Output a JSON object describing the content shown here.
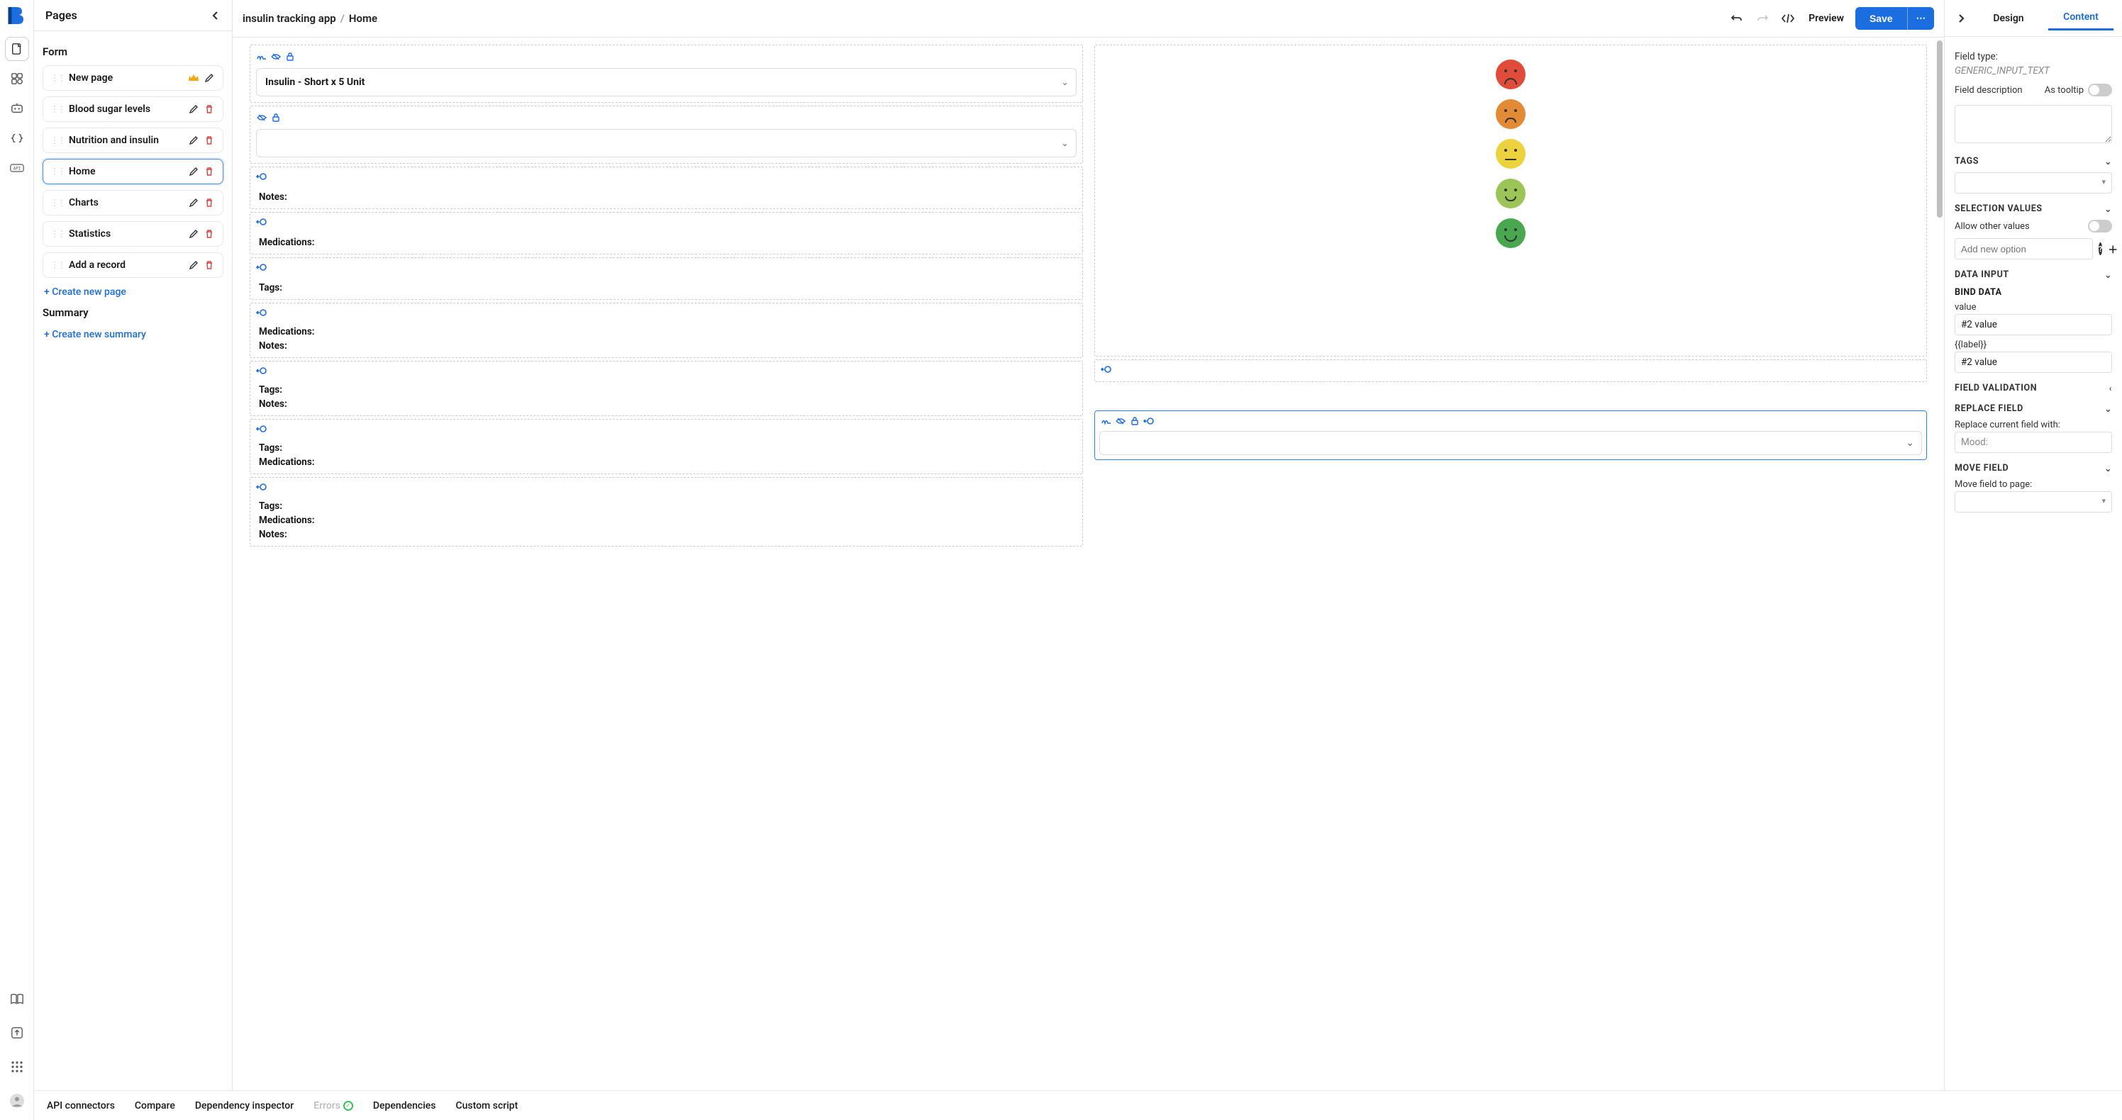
{
  "sidebar": {
    "title": "Pages",
    "sections": {
      "form": "Form",
      "summary": "Summary"
    },
    "pages": [
      {
        "label": "New page",
        "crown": true,
        "trash": false
      },
      {
        "label": "Blood sugar levels",
        "crown": false,
        "trash": true
      },
      {
        "label": "Nutrition and insulin",
        "crown": false,
        "trash": true
      },
      {
        "label": "Home",
        "crown": false,
        "trash": true,
        "selected": true
      },
      {
        "label": "Charts",
        "crown": false,
        "trash": true
      },
      {
        "label": "Statistics",
        "crown": false,
        "trash": true
      },
      {
        "label": "Add a record",
        "crown": false,
        "trash": true
      }
    ],
    "create_page": "+ Create new page",
    "create_summary": "+ Create new summary"
  },
  "breadcrumb": {
    "project": "insulin tracking app",
    "page": "Home"
  },
  "topbar": {
    "preview": "Preview",
    "save": "Save"
  },
  "canvas": {
    "insulin_select": "Insulin - Short x 5 Unit",
    "labels": {
      "notes": "Notes:",
      "medications": "Medications:",
      "tags": "Tags:"
    }
  },
  "rightPanel": {
    "tabs": {
      "design": "Design",
      "content": "Content"
    },
    "field_type_label": "Field type:",
    "field_type_value": "GENERIC_INPUT_TEXT",
    "field_desc_label": "Field description",
    "as_tooltip": "As tooltip",
    "sections": {
      "tags": "TAGS",
      "selection_values": "SELECTION VALUES",
      "allow_other": "Allow other values",
      "add_option_placeholder": "Add new option",
      "data_input": "DATA INPUT",
      "bind_data": "BIND DATA",
      "bind_value_label": "value",
      "bind_value": "#2 value",
      "bind_label_label": "{{label}}",
      "bind_label_value": "#2 value",
      "field_validation": "FIELD VALIDATION",
      "replace_field": "REPLACE FIELD",
      "replace_hint": "Replace current field with:",
      "replace_placeholder": "Mood:",
      "move_field": "MOVE FIELD",
      "move_hint": "Move field to page:"
    }
  },
  "bottomBar": {
    "api": "API connectors",
    "compare": "Compare",
    "dep_inspector": "Dependency inspector",
    "errors": "Errors",
    "dependencies": "Dependencies",
    "custom_script": "Custom script"
  }
}
